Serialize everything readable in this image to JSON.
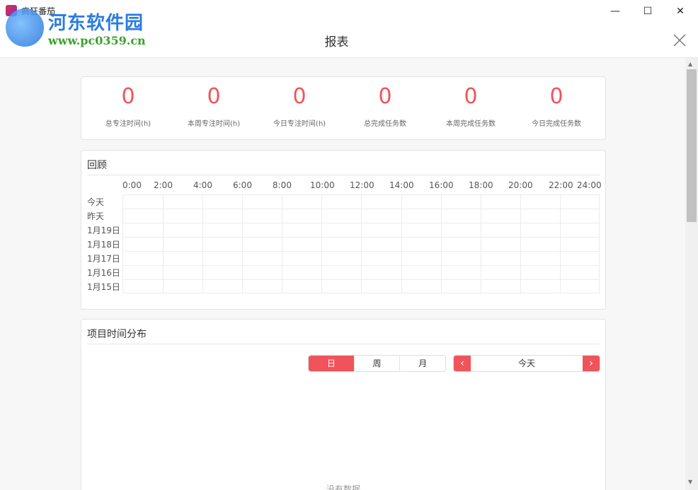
{
  "window": {
    "app_title": "疯狂番茄",
    "minimize_glyph": "—",
    "maximize_glyph": "☐",
    "close_glyph": "✕"
  },
  "watermark": {
    "title": "河东软件园",
    "url": "www.pc0359.cn"
  },
  "header": {
    "title": "报表"
  },
  "stats": [
    {
      "value": "0",
      "label": "总专注时间(h)"
    },
    {
      "value": "0",
      "label": "本周专注时间(h)"
    },
    {
      "value": "0",
      "label": "今日专注时间(h)"
    },
    {
      "value": "0",
      "label": "总完成任务数"
    },
    {
      "value": "0",
      "label": "本周完成任务数"
    },
    {
      "value": "0",
      "label": "今日完成任务数"
    }
  ],
  "review": {
    "title": "回顾",
    "time_ticks": [
      "0:00",
      "2:00",
      "4:00",
      "6:00",
      "8:00",
      "10:00",
      "12:00",
      "14:00",
      "16:00",
      "18:00",
      "20:00",
      "22:00",
      "24:00"
    ],
    "days": [
      "今天",
      "昨天",
      "1月19日",
      "1月18日",
      "1月17日",
      "1月16日",
      "1月15日"
    ]
  },
  "distribution": {
    "title": "项目时间分布",
    "tabs": [
      {
        "label": "日",
        "active": true
      },
      {
        "label": "周",
        "active": false
      },
      {
        "label": "月",
        "active": false
      }
    ],
    "date_label": "今天",
    "prev_glyph": "‹",
    "next_glyph": "›",
    "empty_text": "没有数据"
  },
  "colors": {
    "accent": "#f0545a"
  }
}
